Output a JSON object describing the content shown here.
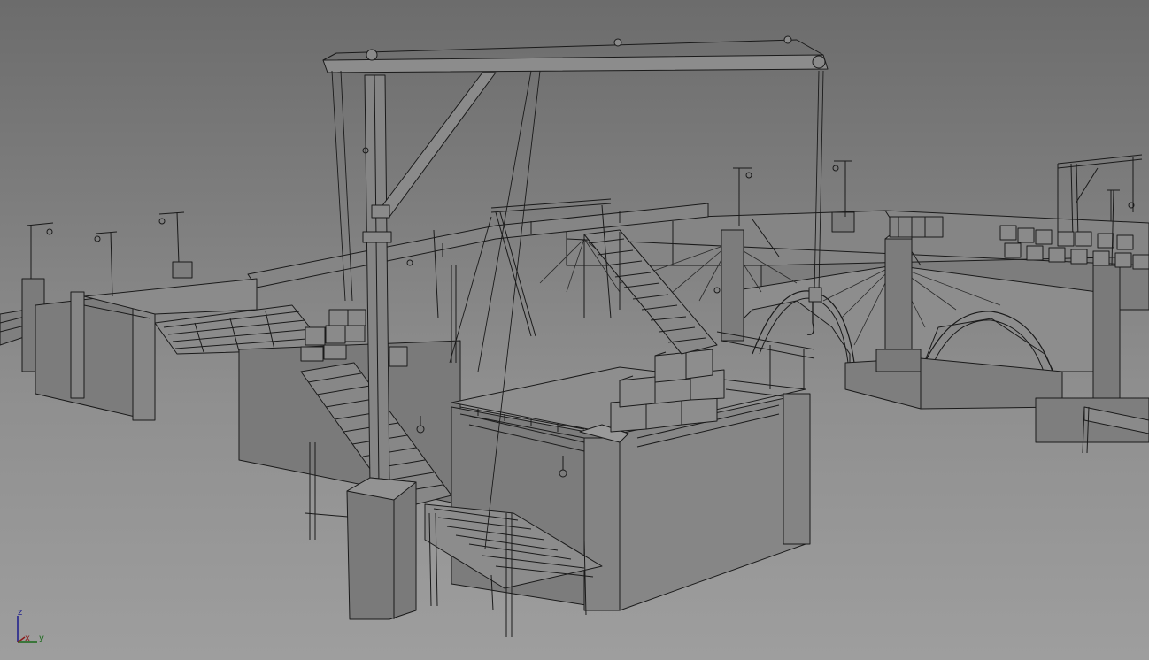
{
  "viewport": {
    "mode": "wireframe-shaded",
    "background_top": "#6c6c6c",
    "background_bottom": "#9e9e9e",
    "line_color": "#1a1a1a",
    "surface_light": "#8a8a8a",
    "surface_mid": "#7a7a7a",
    "surface_dark": "#6a6a6a"
  },
  "scene": {
    "objects": [
      "central-crane",
      "distant-crane",
      "crate-stacks",
      "stone-piers",
      "arched-bridges",
      "wooden-stairs",
      "wooden-walkways",
      "lamp-posts"
    ]
  },
  "axis_gizmo": {
    "z": "z",
    "x": "x",
    "y": "y",
    "z_color": "#1b1b8c",
    "x_color": "#8a1b1b",
    "y_color": "#1b6a1b"
  }
}
